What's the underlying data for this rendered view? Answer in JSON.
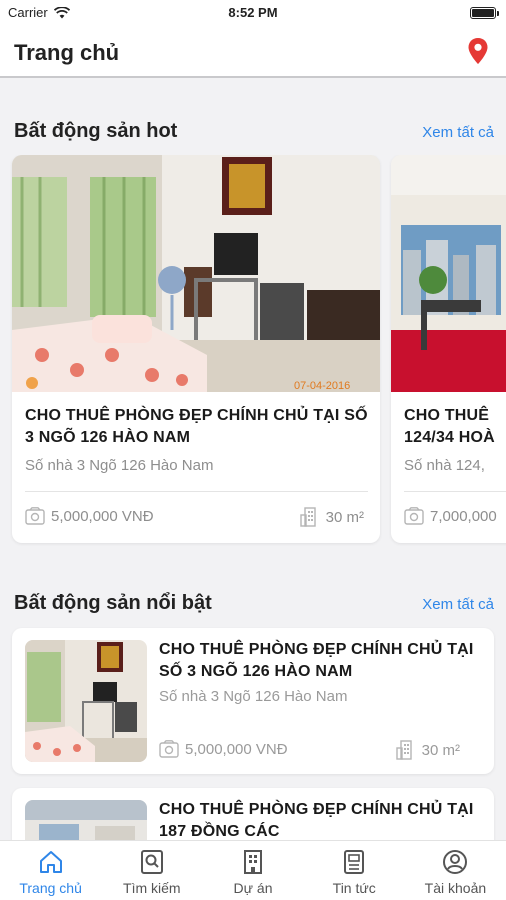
{
  "status_bar": {
    "carrier": "Carrier",
    "time": "8:52 PM"
  },
  "header": {
    "title": "Trang chủ",
    "location_icon": "map-pin-icon",
    "location_color": "#e53935"
  },
  "hot_section": {
    "title": "Bất động sản hot",
    "see_all": "Xem tất cả",
    "cards": [
      {
        "title": "CHO THUÊ PHÒNG ĐẸP CHÍNH CHỦ TẠI SỐ 3 NGÕ 126 HÀO NAM",
        "address": "Số nhà 3 Ngõ 126 Hào Nam",
        "price": "5,000,000 VNĐ",
        "area": "30 m²",
        "photo_stamp": "07-04-2016"
      },
      {
        "title": "CHO THUÊ ",
        "title_line2": "124/34 HOÀ",
        "address": "Số nhà 124, ",
        "price": "7,000,000",
        "area": ""
      }
    ]
  },
  "featured_section": {
    "title": "Bất động sản nổi bật",
    "see_all": "Xem tất cả",
    "items": [
      {
        "title": "CHO THUÊ PHÒNG ĐẸP CHÍNH CHỦ TẠI  SỐ 3 NGÕ 126 HÀO NAM",
        "address": "Số nhà 3 Ngõ 126 Hào Nam",
        "price": "5,000,000 VNĐ",
        "area": "30 m²"
      },
      {
        "title": "CHO THUÊ PHÒNG ĐẸP CHÍNH CHỦ TẠI 187 ĐỒNG CÁC"
      }
    ]
  },
  "tabs": [
    {
      "label": "Trang chủ",
      "icon": "home-icon",
      "active": true
    },
    {
      "label": "Tìm kiếm",
      "icon": "search-icon",
      "active": false
    },
    {
      "label": "Dự án",
      "icon": "building-icon",
      "active": false
    },
    {
      "label": "Tin tức",
      "icon": "news-icon",
      "active": false
    },
    {
      "label": "Tài khoản",
      "icon": "account-icon",
      "active": false
    }
  ],
  "colors": {
    "accent": "#2f86e8",
    "background": "#f2f2f4",
    "pin": "#e53935"
  }
}
